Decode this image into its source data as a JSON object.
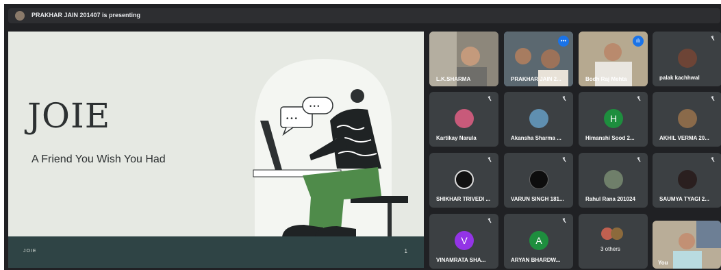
{
  "presenting_banner": "PRAKHAR JAIN 201407 is presenting",
  "slide": {
    "title": "JOIE",
    "subtitle": "A Friend You Wish You Had",
    "footer_label": "JOIE",
    "page_number": "1"
  },
  "participants": [
    {
      "name": "L.K.SHARMA",
      "kind": "video"
    },
    {
      "name": "PRAKHAR JAIN 2...",
      "kind": "video"
    },
    {
      "name": "Bodh Raj Mehta",
      "kind": "video"
    },
    {
      "name": "palak kachhwal",
      "kind": "avatar"
    },
    {
      "name": "Kartikay Narula",
      "kind": "avatar"
    },
    {
      "name": "Akansha Sharma ...",
      "kind": "avatar"
    },
    {
      "name": "Himanshi Sood 2...",
      "kind": "letter",
      "letter": "H"
    },
    {
      "name": "AKHIL VERMA 20...",
      "kind": "avatar"
    },
    {
      "name": "SHIKHAR TRIVEDI ...",
      "kind": "avatar"
    },
    {
      "name": "VARUN SINGH 181...",
      "kind": "avatar"
    },
    {
      "name": "Rahul Rana 201024",
      "kind": "avatar"
    },
    {
      "name": "SAUMYA TYAGI 2...",
      "kind": "avatar"
    },
    {
      "name": "VINAMRATA SHA...",
      "kind": "letter",
      "letter": "V"
    },
    {
      "name": "ARYAN BHARDW...",
      "kind": "letter",
      "letter": "A"
    },
    {
      "name": "3 others",
      "kind": "group"
    },
    {
      "name": "You",
      "kind": "self"
    }
  ],
  "colors": {
    "himanshi": "#1e8e3e",
    "vinamrata": "#9334e6",
    "aryan": "#1e8e3e",
    "footer": "#2f4445",
    "speaking_badge": "#1a73e8"
  }
}
